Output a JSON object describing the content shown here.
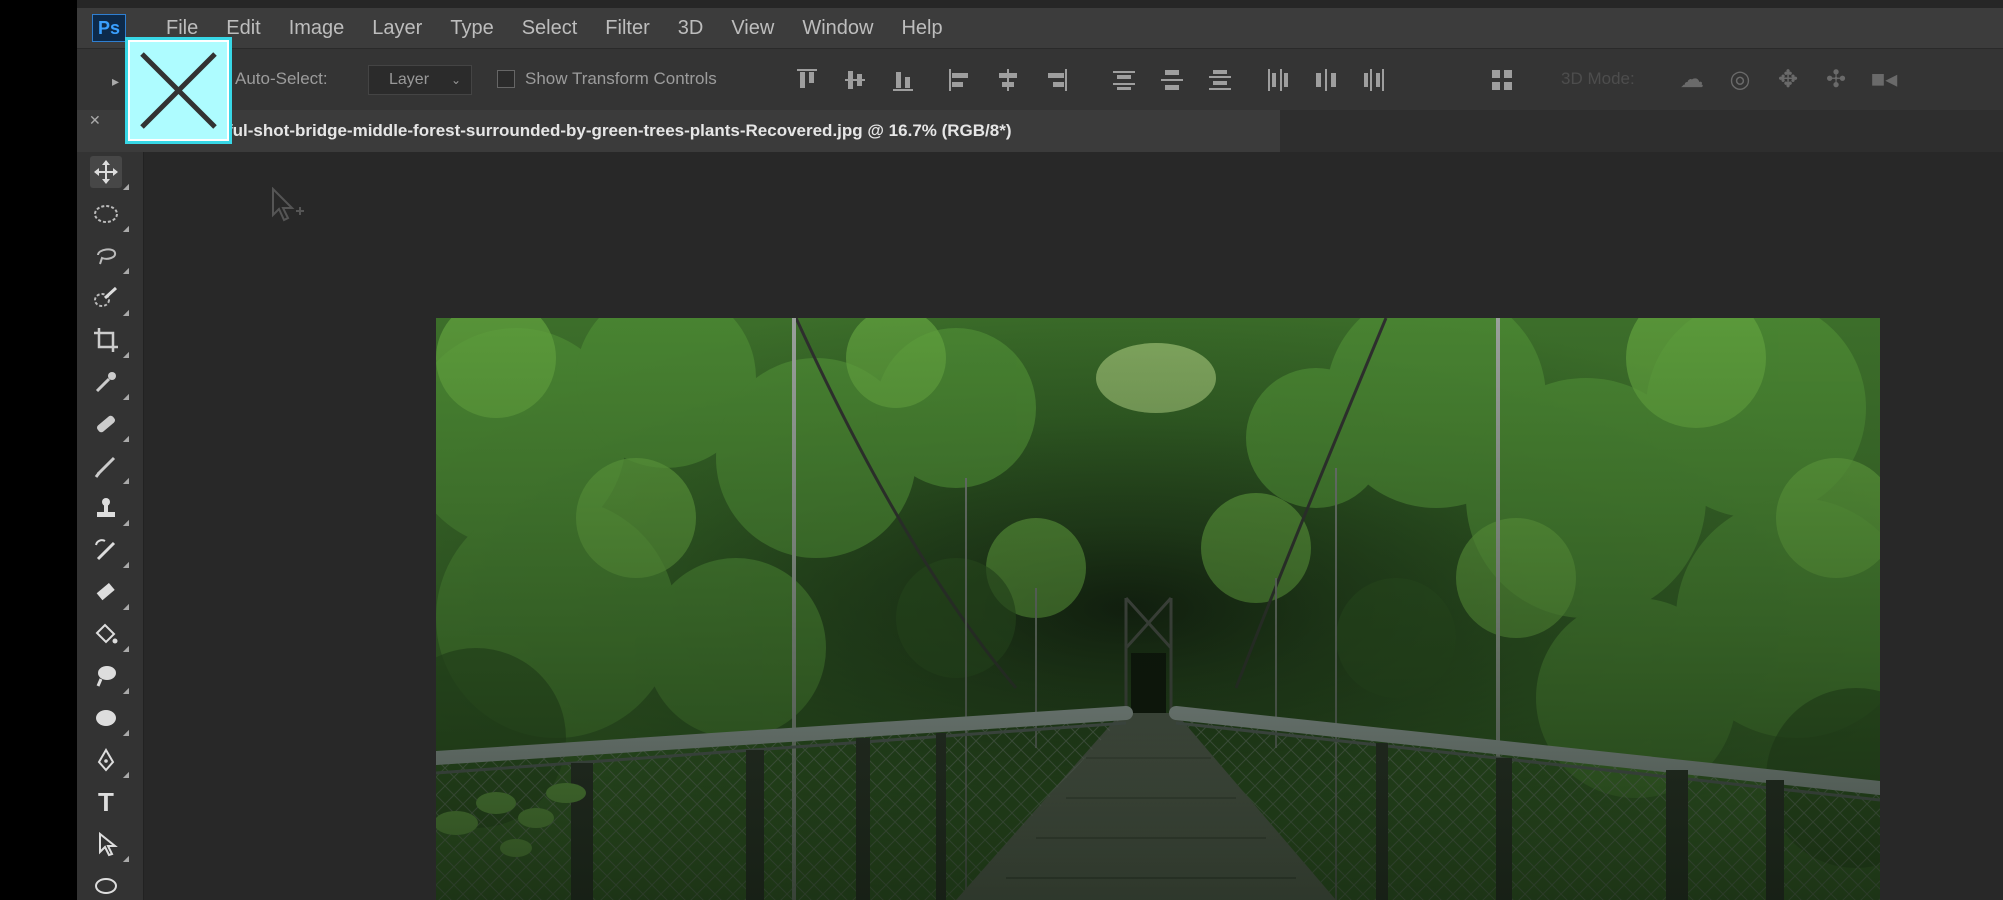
{
  "menu": {
    "logo": "Ps",
    "items": [
      "File",
      "Edit",
      "Image",
      "Layer",
      "Type",
      "Select",
      "Filter",
      "3D",
      "View",
      "Window",
      "Help"
    ]
  },
  "options": {
    "auto_select_label": "Auto-Select:",
    "layer_select_value": "Layer",
    "show_transform_label": "Show Transform Controls",
    "mode_3d_label": "3D Mode:"
  },
  "document": {
    "title": "ful-shot-bridge-middle-forest-surrounded-by-green-trees-plants-Recovered.jpg @ 16.7% (RGB/8*)"
  },
  "colors": {
    "accent_highlight": "#aefcff",
    "photoshop_blue": "#31a8ff",
    "app_background": "#262626"
  },
  "toolbar": {
    "tools": [
      "move-tool",
      "marquee-tool",
      "lasso-tool",
      "quick-selection-tool",
      "crop-tool",
      "eyedropper-tool",
      "healing-brush-tool",
      "brush-tool",
      "clone-stamp-tool",
      "history-brush-tool",
      "eraser-tool",
      "paint-bucket-tool",
      "smudge-tool",
      "dodge-tool",
      "pen-tool",
      "type-tool",
      "path-selection-tool",
      "ellipse-tool"
    ],
    "type_tool_glyph": "T"
  }
}
